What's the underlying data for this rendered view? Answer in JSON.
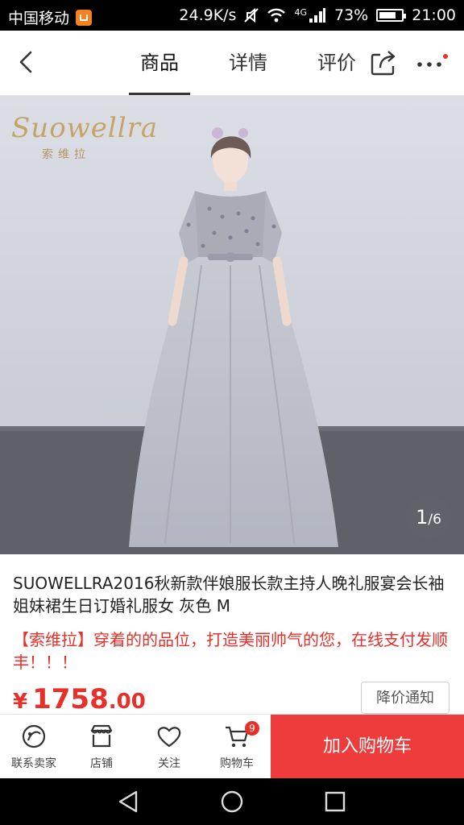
{
  "status_bar": {
    "carrier": "中国移动",
    "speed": "24.9K/s",
    "network": "4G",
    "battery": "73%",
    "time": "21:00"
  },
  "nav": {
    "tabs": [
      "商品",
      "详情",
      "评价"
    ],
    "active_tab": "商品"
  },
  "gallery": {
    "brand_script": "Suowellra",
    "brand_cn": "索维拉",
    "current": "1",
    "total": "/6"
  },
  "product": {
    "title": "SUOWELLRA2016秋新款伴娘服长款主持人晚礼服宴会长袖姐妹裙生日订婚礼服女 灰色 M",
    "promo": "【索维拉】穿着的的品位，打造美丽帅气的您，在线支付发顺丰！！！",
    "price_symbol": "¥",
    "price_int": "1758",
    "price_dec": ".00",
    "notify_label": "降价通知"
  },
  "bottom_bar": {
    "contact_label": "联系卖家",
    "store_label": "店铺",
    "follow_label": "关注",
    "cart_label": "购物车",
    "cart_count": "9",
    "add_to_cart_label": "加入购物车"
  },
  "colors": {
    "accent_red": "#e8302a",
    "add_cart_bg": "#ee3b3b"
  }
}
